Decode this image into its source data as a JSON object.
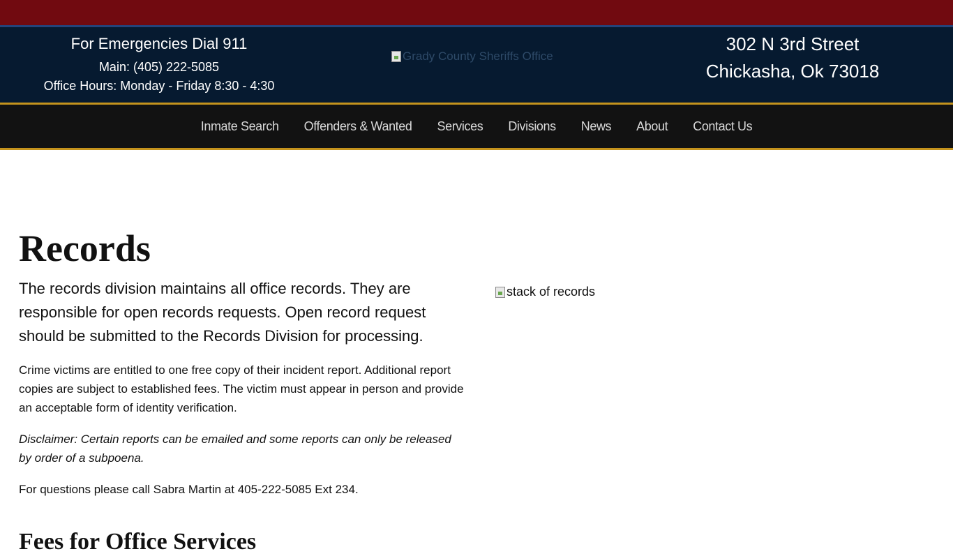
{
  "header": {
    "emergency": "For Emergencies Dial 911",
    "main_phone": "Main: (405) 222-5085",
    "hours": "Office Hours: Monday - Friday 8:30 - 4:30",
    "logo_alt": "Grady County Sheriffs Office",
    "address_line1": "302 N 3rd Street",
    "address_line2": "Chickasha, Ok 73018"
  },
  "nav": {
    "items": [
      {
        "label": "Inmate Search"
      },
      {
        "label": "Offenders & Wanted"
      },
      {
        "label": "Services"
      },
      {
        "label": "Divisions"
      },
      {
        "label": "News"
      },
      {
        "label": "About"
      },
      {
        "label": "Contact Us"
      }
    ]
  },
  "main": {
    "title": "Records",
    "lead": "The records division maintains all office records. They are responsible for open records requests. Open record request should be submitted to the Records Division for processing.",
    "p1": "Crime victims are entitled to one free copy of their incident report. Additional report copies are subject to established fees. The victim must appear in person and provide an acceptable form of identity verification.",
    "disclaimer": "Disclaimer: Certain reports can be emailed and some reports can only be released by order of a subpoena.",
    "questions": "For questions please call Sabra Martin at 405-222-5085 Ext 234.",
    "next_heading": "Fees for Office Services",
    "image_alt": "stack of records"
  },
  "colors": {
    "topbar": "#710a10",
    "header_bg": "#061a30",
    "nav_bg": "#121212",
    "gold_accent": "#c4931d"
  }
}
